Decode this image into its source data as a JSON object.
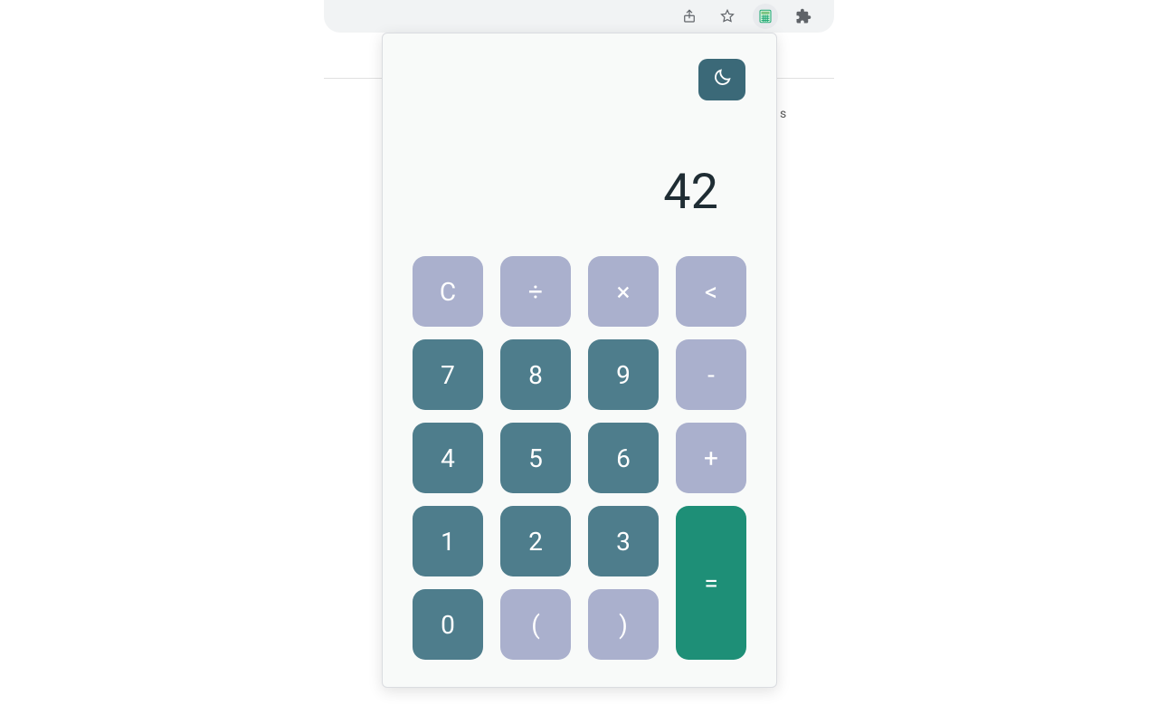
{
  "toolbar": {
    "share_icon": "share-icon",
    "star_icon": "star-icon",
    "calculator_icon": "calculator-icon",
    "extensions_icon": "extensions-icon"
  },
  "calculator": {
    "display_value": "42",
    "theme_button_icon": "moon-icon",
    "keys": {
      "clear": "C",
      "divide": "÷",
      "multiply": "×",
      "backspace": "<",
      "seven": "7",
      "eight": "8",
      "nine": "9",
      "minus": "-",
      "four": "4",
      "five": "5",
      "six": "6",
      "plus": "+",
      "one": "1",
      "two": "2",
      "three": "3",
      "equals": "=",
      "zero": "0",
      "paren_open": "(",
      "paren_close": ")"
    }
  },
  "background": {
    "stray_char": "s"
  }
}
